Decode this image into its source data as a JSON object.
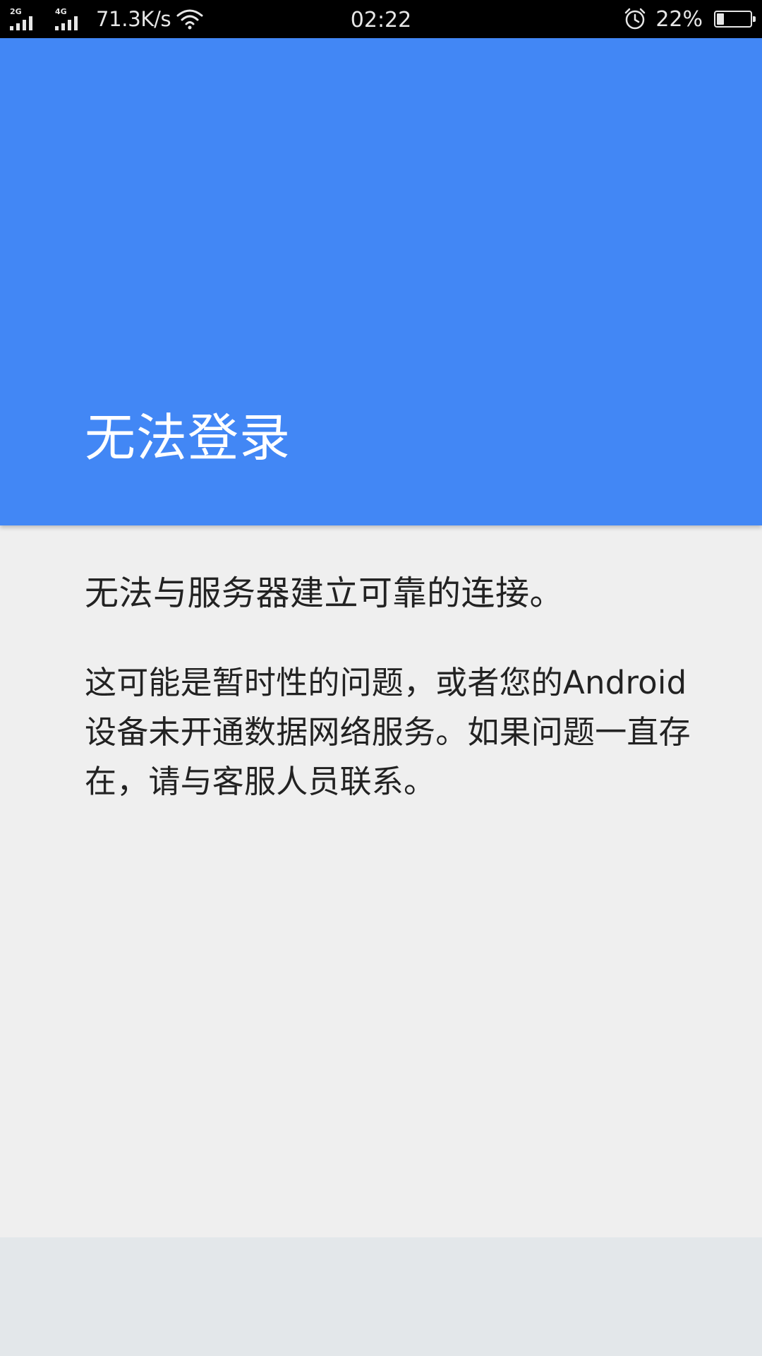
{
  "status_bar": {
    "net_type_1": "2G",
    "net_type_2": "4G",
    "net_speed": "71.3K/s",
    "time": "02:22",
    "battery_percent": "22%",
    "battery_level": 0.22,
    "icons": [
      "signal-2g-icon",
      "signal-4g-icon",
      "wifi-icon",
      "alarm-icon",
      "battery-icon"
    ]
  },
  "header": {
    "title": "无法登录",
    "background_color": "#4287f5"
  },
  "content": {
    "primary_message": "无法与服务器建立可靠的连接。",
    "secondary_message": "这可能是暂时性的问题，或者您的Android设备未开通数据网络服务。如果问题一直存在，请与客服人员联系。"
  }
}
